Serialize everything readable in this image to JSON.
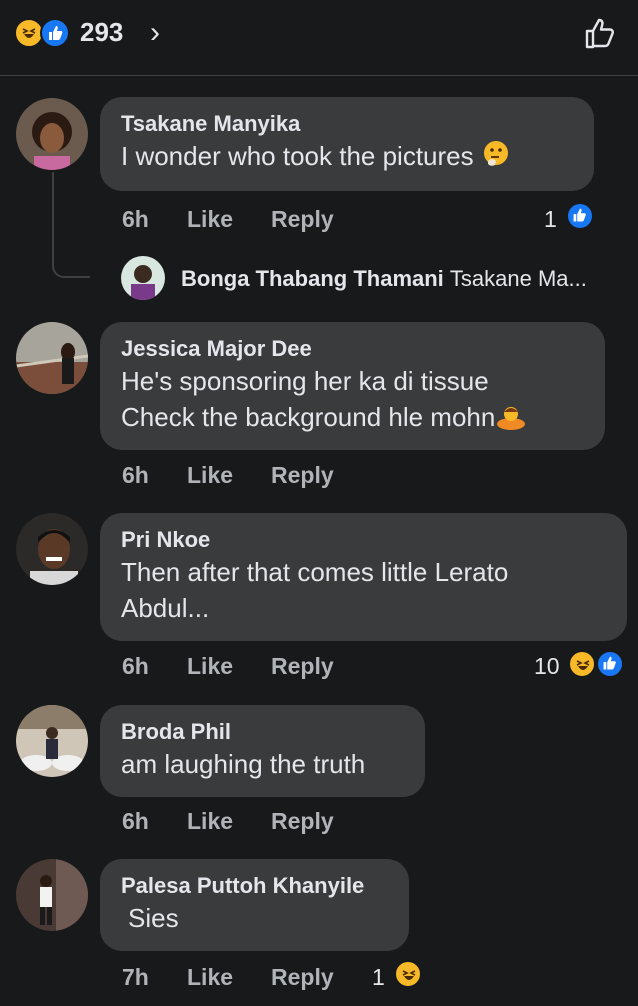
{
  "header": {
    "reaction_count": "293",
    "chevron": "›",
    "reaction_icons": [
      "haha-icon",
      "like-icon"
    ],
    "action_icon": "thumbs-up-outline-icon"
  },
  "colors": {
    "background": "#18191a",
    "bubble": "#3a3b3c",
    "like_blue": "#1877f2",
    "haha_yellow": "#f7b928",
    "meta_text": "#b0b3b8"
  },
  "comments": [
    {
      "author": "Tsakane Manyika",
      "text": "I wonder who took the pictures",
      "emoji": "thinking-face-icon",
      "time": "6h",
      "like_label": "Like",
      "reply_label": "Reply",
      "reaction_count": "1",
      "reactions": [
        "like-icon"
      ],
      "reply_preview": {
        "author": "Bonga Thabang Thamani",
        "snippet": "Tsakane Ma..."
      }
    },
    {
      "author": "Jessica Major Dee",
      "text": "He's sponsoring her ka di tissue\nCheck the background hle mohn",
      "emoji": "person-bowing-icon",
      "time": "6h",
      "like_label": "Like",
      "reply_label": "Reply"
    },
    {
      "author": "Pri Nkoe",
      "text": "Then after that comes little Lerato\nAbdul...",
      "time": "6h",
      "like_label": "Like",
      "reply_label": "Reply",
      "reaction_count": "10",
      "reactions": [
        "haha-icon",
        "like-icon"
      ]
    },
    {
      "author": "Broda Phil",
      "text": "am laughing the truth",
      "time": "6h",
      "like_label": "Like",
      "reply_label": "Reply"
    },
    {
      "author": "Palesa Puttoh Khanyile",
      "text": "Sies",
      "time": "7h",
      "like_label": "Like",
      "reply_label": "Reply",
      "reaction_count": "1",
      "reactions": [
        "haha-icon"
      ]
    }
  ]
}
